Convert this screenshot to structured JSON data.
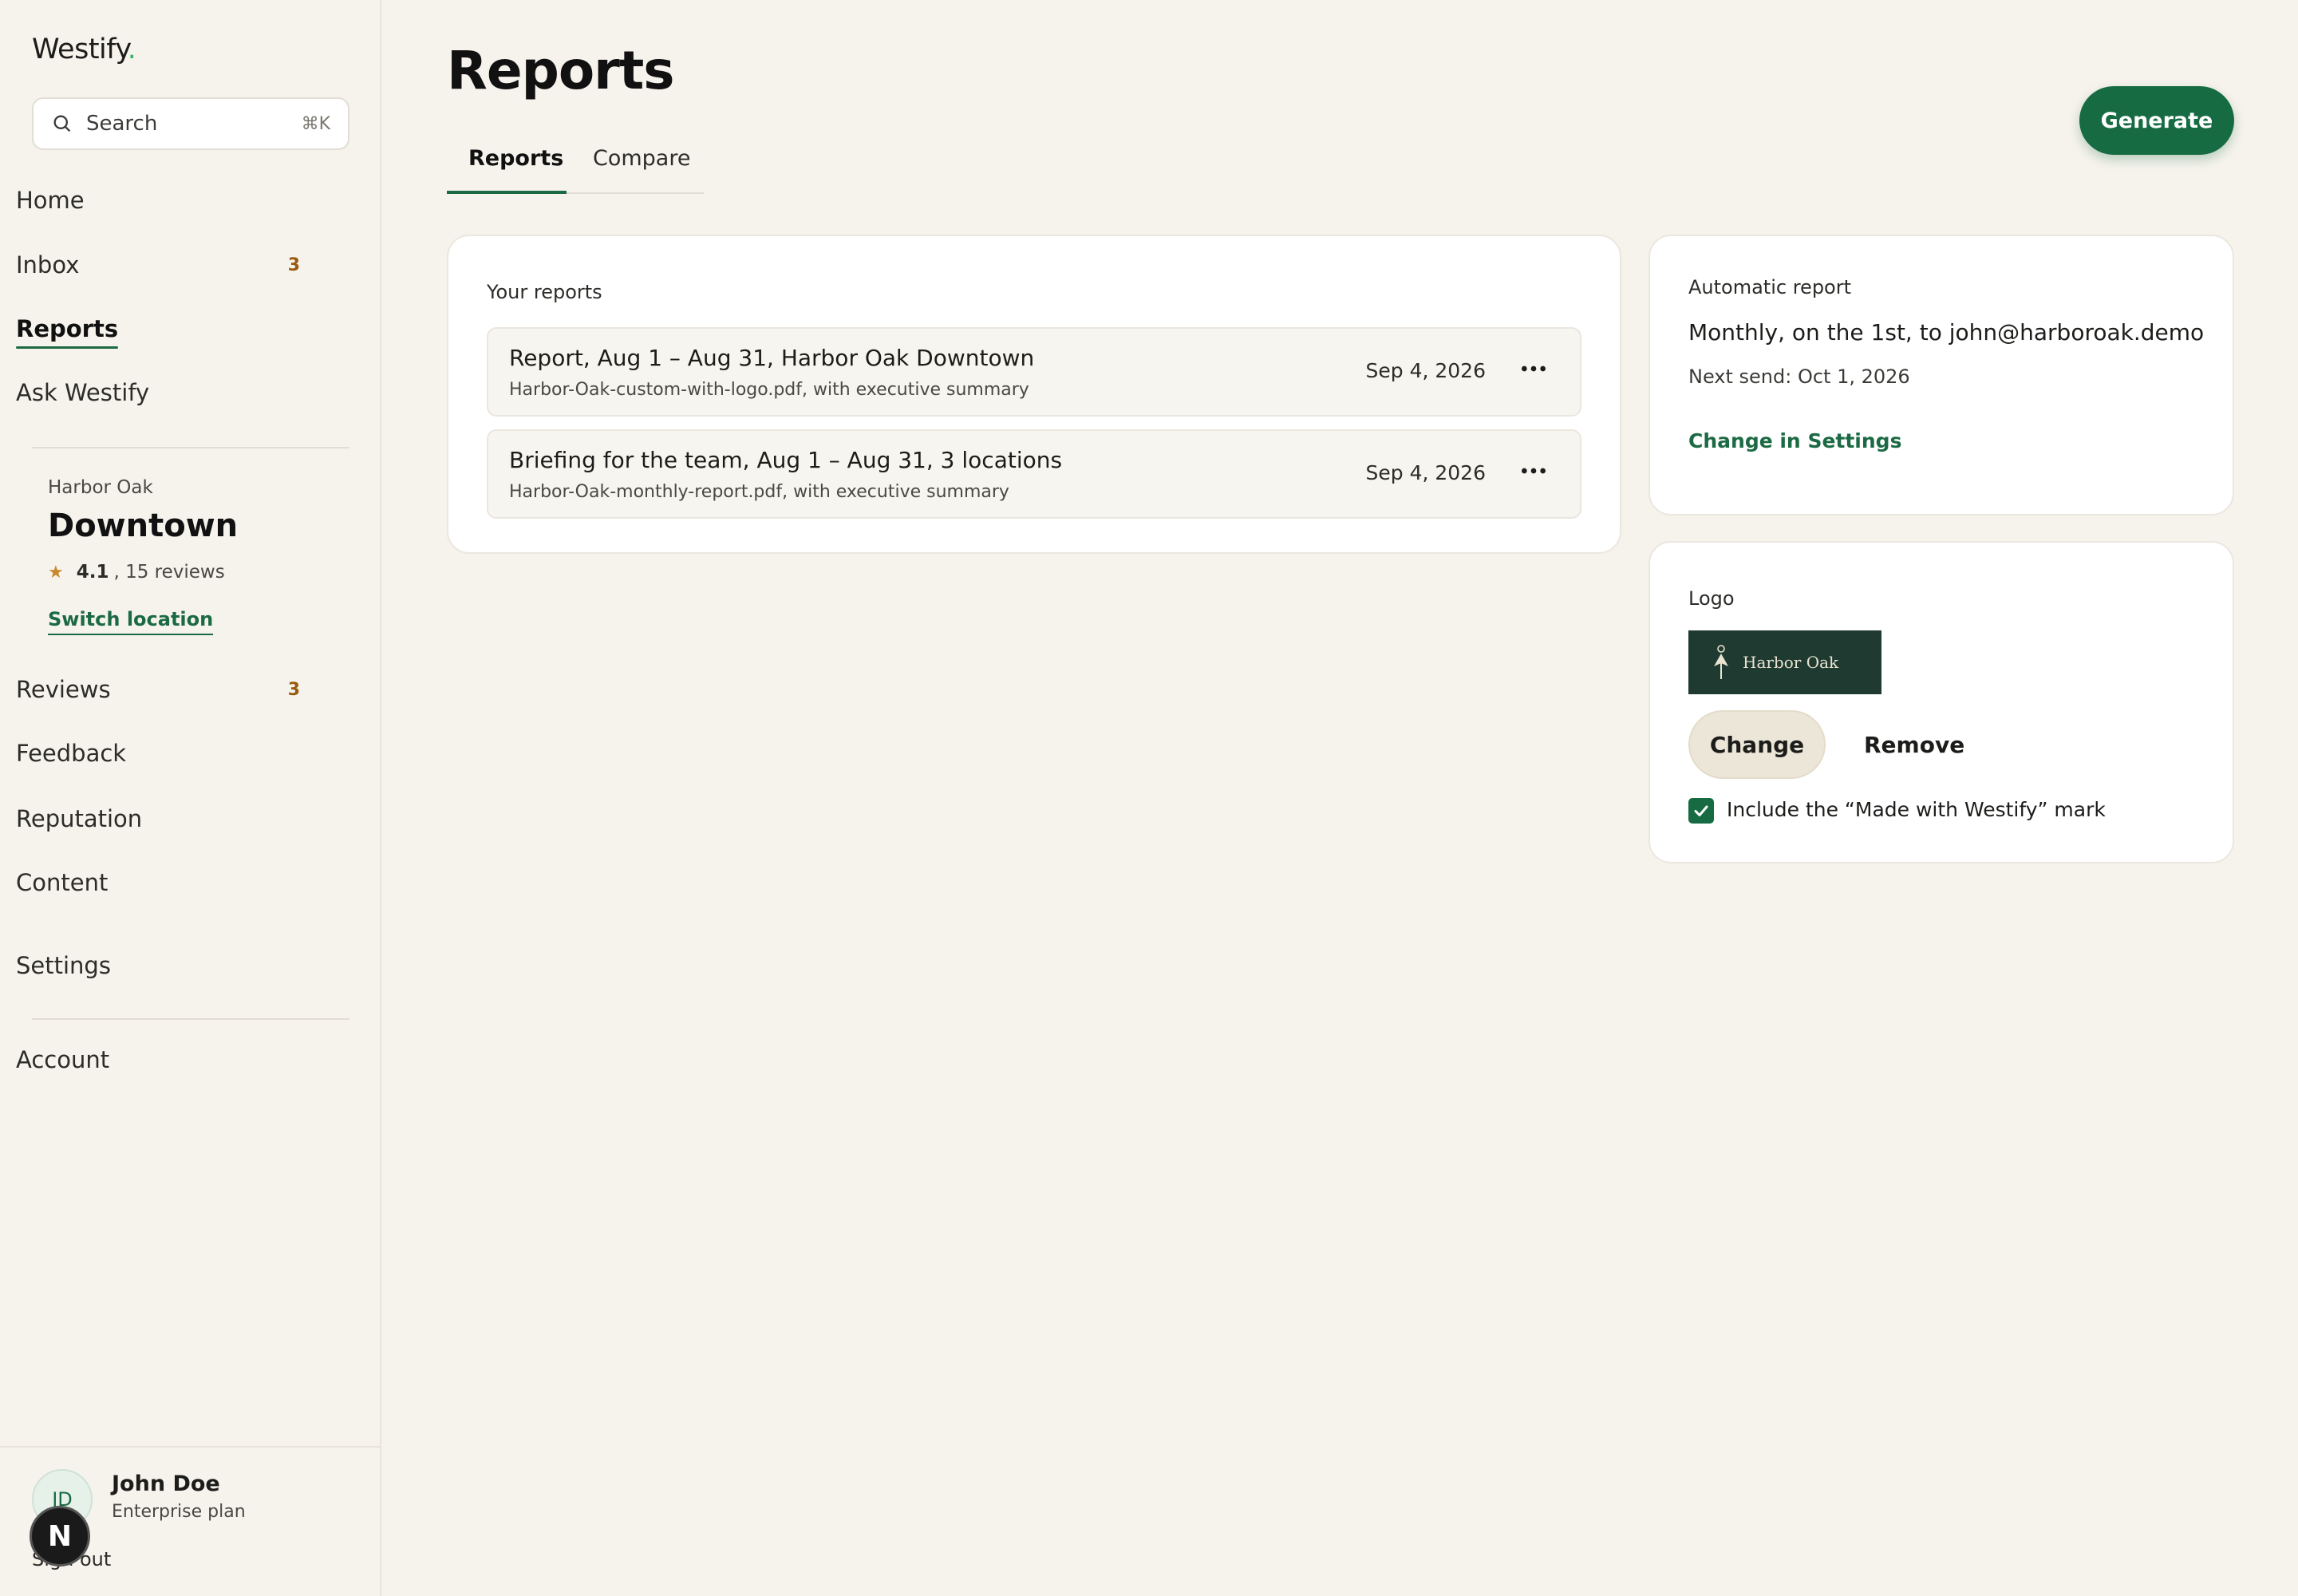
{
  "app": {
    "name": "Westify",
    "name_dot": "."
  },
  "search": {
    "label": "Search",
    "shortcut": "⌘K"
  },
  "nav_primary": [
    {
      "label": "Home",
      "badge": ""
    },
    {
      "label": "Inbox",
      "badge": "3"
    },
    {
      "label": "Reports",
      "badge": "",
      "active": true
    },
    {
      "label": "Ask Westify",
      "badge": ""
    }
  ],
  "location": {
    "org": "Harbor Oak",
    "name": "Downtown",
    "rating": "4.1",
    "reviews": ", 15 reviews",
    "switch_label": "Switch location"
  },
  "nav_location": [
    {
      "label": "Reviews",
      "badge": "3"
    },
    {
      "label": "Feedback",
      "badge": ""
    },
    {
      "label": "Reputation",
      "badge": ""
    },
    {
      "label": "Content",
      "badge": ""
    },
    {
      "label": "Settings",
      "badge": ""
    }
  ],
  "nav_account": {
    "label": "Account"
  },
  "user": {
    "initials": "JD",
    "name": "John Doe",
    "plan": "Enterprise plan",
    "sign_out": "Sign out"
  },
  "dev_badge": {
    "letter": "N"
  },
  "page": {
    "title": "Reports",
    "generate_label": "Generate"
  },
  "tabs": [
    {
      "label": "Reports",
      "active": true
    },
    {
      "label": "Compare",
      "active": false
    }
  ],
  "reports_card": {
    "label": "Your reports",
    "items": [
      {
        "title": "Report, Aug 1 – Aug 31, Harbor Oak Downtown",
        "file": "Harbor-Oak-custom-with-logo.pdf, with executive summary",
        "date": "Sep 4, 2026"
      },
      {
        "title": "Briefing for the team, Aug 1 – Aug 31, 3 locations",
        "file": "Harbor-Oak-monthly-report.pdf, with executive summary",
        "date": "Sep 4, 2026"
      }
    ]
  },
  "auto_report": {
    "label": "Automatic report",
    "schedule": "Monthly, on the 1st, to john@harboroak.demo",
    "next_send": "Next send: Oct 1, 2026",
    "link": "Change in Settings"
  },
  "logo_card": {
    "label": "Logo",
    "preview_text": "Harbor Oak",
    "change_label": "Change",
    "remove_label": "Remove",
    "mark_label": "Include the “Made with Westify” mark",
    "mark_checked": true
  },
  "colors": {
    "accent": "#176b43",
    "background": "#f6f3ec",
    "badge": "#9a5a10",
    "star": "#c7892c"
  }
}
